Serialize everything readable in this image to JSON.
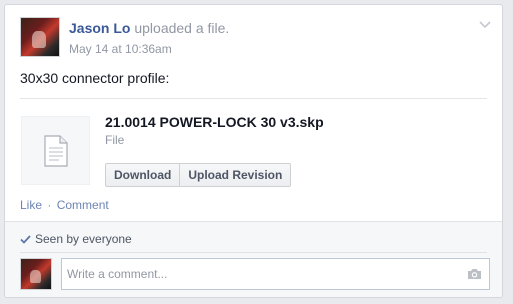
{
  "post": {
    "author": "Jason Lo",
    "action": " uploaded a file.",
    "timestamp": "May 14 at 10:36am",
    "text": "30x30 connector profile:"
  },
  "file": {
    "name": "21.0014 POWER-LOCK 30 v3.skp",
    "type": "File",
    "download_label": "Download",
    "upload_revision_label": "Upload Revision",
    "thumb_icon": "document-icon"
  },
  "actions": {
    "like": "Like",
    "separator": "·",
    "comment": "Comment"
  },
  "ufi": {
    "seen_text": "Seen by everyone",
    "comment_placeholder": "Write a comment..."
  },
  "colors": {
    "link": "#3b5998",
    "muted": "#9197a3",
    "action_link": "#6d84b4",
    "background": "#e9eaed"
  }
}
